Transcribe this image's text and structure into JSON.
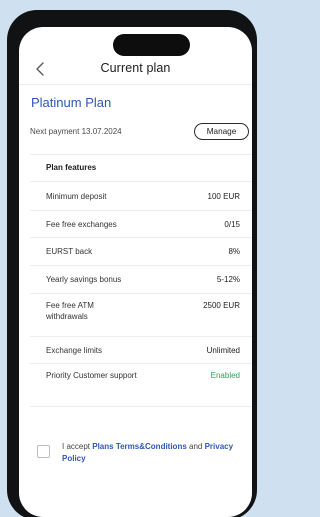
{
  "header": {
    "title": "Current plan",
    "back_icon": "chevron-left-icon"
  },
  "plan": {
    "name": "Platinum Plan",
    "next_payment": "Next payment 13.07.2024",
    "manage_label": "Manage"
  },
  "features": {
    "heading": "Plan features",
    "rows": [
      {
        "label": "Minimum deposit",
        "value": "100 EUR"
      },
      {
        "label": "Fee free exchanges",
        "value": "0/15"
      },
      {
        "label": "EURST back",
        "value": "8%"
      },
      {
        "label": "Yearly savings bonus",
        "value": "5-12%"
      },
      {
        "label": "Fee free ATM withdrawals",
        "value": "2500 EUR"
      },
      {
        "label": "Exchange limits",
        "value": "Unlimited"
      },
      {
        "label": "Priority Customer support",
        "value": "Enabled"
      }
    ]
  },
  "terms": {
    "prefix": "I accept ",
    "link1": "Plans Terms&Conditions",
    "middle": " and ",
    "link2": "Privacy Policy",
    "checked": false
  },
  "colors": {
    "accent": "#2e58b3",
    "enabled": "#2f9e58",
    "background": "#cfe1f1",
    "phone": "#111214"
  }
}
